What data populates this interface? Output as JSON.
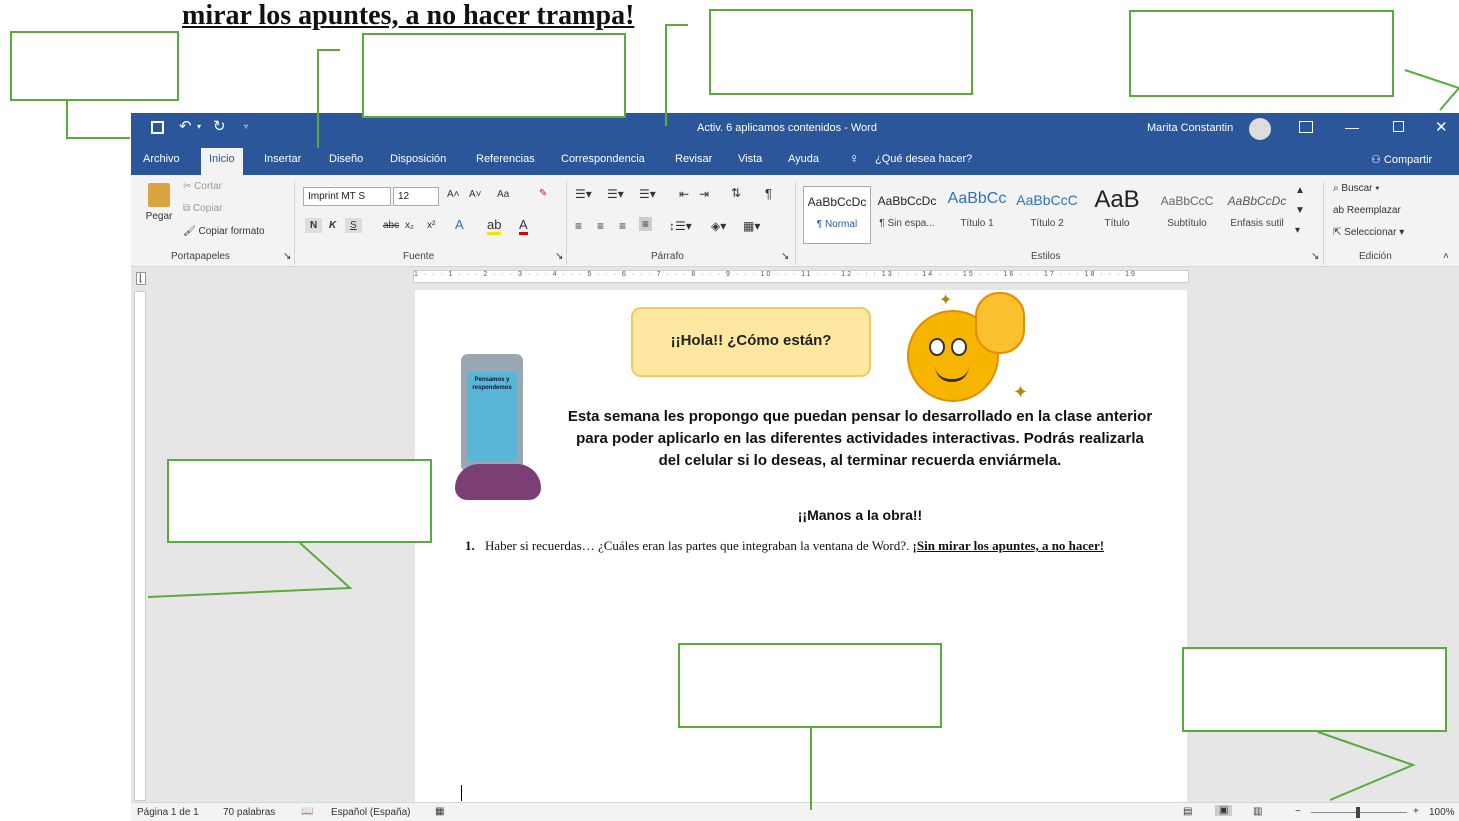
{
  "heading": "mirar los apuntes, a no hacer trampa!",
  "window": {
    "title": "Activ. 6 aplicamos contenidos - Word",
    "user": "Marita Constantin"
  },
  "tabs": [
    "Archivo",
    "Inicio",
    "Insertar",
    "Diseño",
    "Disposición",
    "Referencias",
    "Correspondencia",
    "Revisar",
    "Vista",
    "Ayuda"
  ],
  "tell_me": "¿Qué desea hacer?",
  "share": "Compartir",
  "clipboard": {
    "paste": "Pegar",
    "cut": "Cortar",
    "copy": "Copiar",
    "format_painter": "Copiar formato",
    "label": "Portapapeles"
  },
  "font": {
    "name": "Imprint MT S",
    "size": "12",
    "bold": "N",
    "italic": "K",
    "underline": "S",
    "strike": "abc",
    "sub": "x₂",
    "sup": "x²",
    "case": "Aa",
    "grow": "A˄",
    "shrink": "A˅",
    "label": "Fuente"
  },
  "paragraph": {
    "label": "Párrafo",
    "pilcrow": "¶"
  },
  "styles": {
    "items": [
      {
        "sample": "AaBbCcDc",
        "name": "¶ Normal"
      },
      {
        "sample": "AaBbCcDc",
        "name": "¶ Sin espa..."
      },
      {
        "sample": "AaBbCc",
        "name": "Título 1"
      },
      {
        "sample": "AaBbCcC",
        "name": "Título 2"
      },
      {
        "sample": "AaB",
        "name": "Título"
      },
      {
        "sample": "AaBbCcC",
        "name": "Subtítulo"
      },
      {
        "sample": "AaBbCcDc",
        "name": "Énfasis sutil"
      }
    ],
    "label": "Estilos"
  },
  "editing": {
    "find": "Buscar",
    "replace": "Reemplazar",
    "select": "Seleccionar",
    "label": "Edición"
  },
  "ruler": "1 · · · 1 · · · 2 · · · 3 · · · 4 · · · 5 · · · 6 · · · 7 · · · 8 · · · 9 · · · 10 · · · 11 · · · 12 · · · 13 · · · 14 · · · 15 · · · 16 · · · 17 · · · 18 · · · 19",
  "document": {
    "phone_text": "Pensamos y respondemos",
    "bubble": "¡¡Hola!! ¿Cómo están?",
    "paragraph": "Esta semana les propongo que puedan pensar lo desarrollado en la clase anterior para poder aplicarlo en las diferentes actividades interactivas.   Podrás realizarla del celular si lo deseas, al terminar recuerda enviármela.",
    "manos": "¡¡Manos a la obra!!",
    "item_number": "1.",
    "item_text": "Haber si recuerdas… ¿Cuáles eran las partes que integraban la ventana de Word?.",
    "item_bold": "¡Sin mirar los apuntes, a no hacer!"
  },
  "status": {
    "page": "Página 1 de 1",
    "words": "70 palabras",
    "language": "Español (España)",
    "zoom": "100%"
  },
  "colors": {
    "word_blue": "#2b579a",
    "callout_green": "#5aaa3c"
  }
}
